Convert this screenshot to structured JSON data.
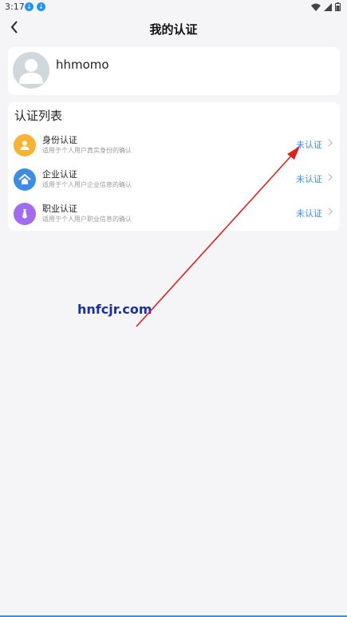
{
  "status_bar": {
    "time": "3:17"
  },
  "header": {
    "title": "我的认证"
  },
  "profile": {
    "username": "hhmomo"
  },
  "cert_list": {
    "title": "认证列表",
    "items": [
      {
        "name": "身份认证",
        "desc": "适用于个人用户真实身份的确认",
        "status": "未认证",
        "icon": "user-icon",
        "color": "#f8b431"
      },
      {
        "name": "企业认证",
        "desc": "适用于个人用户企业信息的确认",
        "status": "未认证",
        "icon": "home-icon",
        "color": "#3c8ee5"
      },
      {
        "name": "职业认证",
        "desc": "适用于个人用户职业信息的确认",
        "status": "未认证",
        "icon": "tie-icon",
        "color": "#a36bf0"
      }
    ]
  },
  "watermark": "hnfcjr.com",
  "colors": {
    "accent": "#3c8ee5",
    "arrow": "#e0201e",
    "background": "#f5f5f7"
  }
}
